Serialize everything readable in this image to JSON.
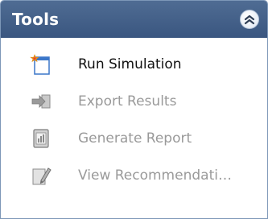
{
  "panel": {
    "title": "Tools",
    "collapse_icon": "double-chevron-up-icon"
  },
  "items": [
    {
      "label": "Run Simulation",
      "icon": "run-simulation-icon",
      "enabled": true
    },
    {
      "label": "Export Results",
      "icon": "export-arrow-icon",
      "enabled": false
    },
    {
      "label": "Generate Report",
      "icon": "report-icon",
      "enabled": false
    },
    {
      "label": "View Recommendati…",
      "icon": "edit-pencil-icon",
      "enabled": false
    }
  ],
  "colors": {
    "header": "#3f5c86",
    "enabled_text": "#111111",
    "disabled_text": "#9a9a9a"
  }
}
